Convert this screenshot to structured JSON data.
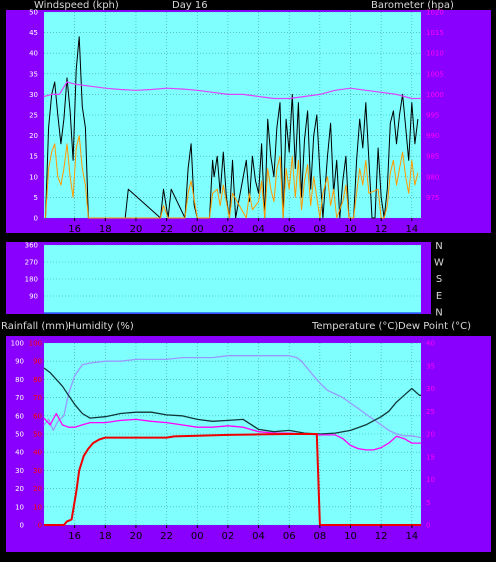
{
  "colors": {
    "background": "#000000",
    "frame": "#8a00ff",
    "plot_bg": "#80ffff",
    "grid": "#40a0a0",
    "label": "#d8d8d8",
    "tick_white": "#ffffff",
    "tick_magenta": "#ff00ff",
    "tick_red": "#ff0000"
  },
  "chart_data": [
    {
      "type": "line",
      "title": "Day 16",
      "ylabel": "Windspeed (kph)",
      "y2label": "Barometer (hpa)",
      "ylim": [
        0,
        50
      ],
      "y2lim": [
        970,
        1020
      ],
      "yticks": [
        0,
        5,
        10,
        15,
        20,
        25,
        30,
        35,
        40,
        45,
        50
      ],
      "y2ticks": [
        975,
        980,
        985,
        990,
        995,
        1000,
        1005,
        1010,
        1015,
        1020
      ],
      "xlim": [
        14.0,
        38.6
      ],
      "xticks": [
        16,
        18,
        20,
        22,
        24,
        26,
        28,
        30,
        32,
        34,
        36,
        38
      ],
      "xticklabels": [
        "16",
        "18",
        "20",
        "22",
        "00",
        "02",
        "04",
        "06",
        "08",
        "10",
        "12",
        "14"
      ],
      "series": [
        {
          "role": "gust",
          "color": "#000000",
          "axis": "left",
          "x": [
            14.1,
            14.3,
            14.5,
            14.7,
            14.9,
            15.1,
            15.3,
            15.5,
            15.7,
            15.9,
            16.1,
            16.3,
            16.5,
            16.7,
            16.9,
            19.3,
            19.5,
            21.6,
            21.8,
            22.1,
            22.3,
            23.2,
            23.4,
            23.6,
            23.8,
            24.0,
            24.8,
            25.0,
            25.1,
            25.3,
            25.5,
            25.7,
            25.9,
            26.1,
            26.3,
            26.5,
            27.2,
            27.4,
            27.6,
            27.8,
            28.0,
            28.2,
            28.4,
            28.6,
            28.8,
            29.0,
            29.2,
            29.4,
            29.6,
            29.8,
            30.0,
            30.2,
            30.4,
            30.6,
            30.8,
            31.0,
            31.2,
            31.4,
            31.6,
            31.8,
            32.0,
            32.2,
            32.5,
            32.7,
            32.9,
            33.1,
            33.3,
            33.5,
            33.7,
            33.9,
            34.2,
            34.4,
            34.6,
            34.8,
            35.0,
            35.2,
            35.4,
            35.6,
            35.8,
            36.0,
            36.2,
            36.4,
            36.6,
            36.8,
            37.0,
            37.2,
            37.4,
            37.6,
            37.8,
            38.0,
            38.2,
            38.4
          ],
          "y": [
            0,
            22,
            30,
            33,
            25,
            18,
            24,
            34,
            26,
            14,
            36,
            44,
            27,
            22,
            0,
            0,
            7,
            0,
            7,
            0,
            7,
            0,
            12,
            18,
            3,
            0,
            0,
            14,
            10,
            15,
            6,
            16,
            5,
            0,
            14,
            0,
            14,
            4,
            15,
            9,
            6,
            18,
            0,
            24,
            15,
            10,
            22,
            28,
            0,
            24,
            16,
            30,
            12,
            28,
            5,
            19,
            26,
            7,
            20,
            25,
            11,
            0,
            15,
            23,
            6,
            14,
            0,
            9,
            15,
            0,
            0,
            14,
            24,
            17,
            28,
            14,
            0,
            0,
            17,
            5,
            0,
            7,
            23,
            26,
            18,
            25,
            30,
            22,
            14,
            28,
            18,
            24
          ]
        },
        {
          "role": "average",
          "color": "#ff9900",
          "axis": "left",
          "x": [
            14.1,
            14.3,
            14.5,
            14.7,
            14.9,
            15.1,
            15.3,
            15.5,
            15.7,
            15.9,
            16.1,
            16.3,
            16.5,
            16.7,
            16.9,
            21.6,
            21.8,
            22.1,
            23.2,
            23.4,
            23.6,
            24.0,
            24.8,
            25.0,
            25.3,
            25.5,
            25.7,
            26.1,
            26.3,
            27.2,
            27.4,
            27.6,
            28.0,
            28.2,
            28.4,
            28.6,
            28.8,
            29.0,
            29.2,
            29.4,
            29.6,
            29.8,
            30.0,
            30.2,
            30.4,
            30.6,
            30.8,
            31.0,
            31.2,
            31.4,
            31.6,
            32.0,
            32.2,
            32.5,
            32.7,
            32.9,
            33.1,
            33.5,
            33.7,
            33.9,
            34.2,
            34.4,
            34.6,
            34.8,
            35.0,
            35.2,
            35.8,
            36.0,
            36.2,
            36.4,
            36.6,
            36.8,
            37.0,
            37.2,
            37.4,
            37.6,
            37.8,
            38.0,
            38.2,
            38.4
          ],
          "y": [
            0,
            12,
            16,
            18,
            10,
            8,
            12,
            18,
            10,
            5,
            17,
            20,
            12,
            8,
            0,
            0,
            3,
            0,
            0,
            6,
            9,
            0,
            0,
            6,
            7,
            3,
            8,
            0,
            6,
            0,
            6,
            2,
            4,
            9,
            0,
            12,
            7,
            4,
            12,
            15,
            0,
            12,
            7,
            15,
            5,
            14,
            2,
            9,
            13,
            3,
            10,
            0,
            6,
            10,
            3,
            7,
            0,
            4,
            8,
            0,
            0,
            6,
            12,
            8,
            14,
            6,
            7,
            0,
            0,
            3,
            11,
            14,
            8,
            12,
            16,
            10,
            6,
            14,
            8,
            11
          ]
        },
        {
          "role": "pressure",
          "color": "#dd44ff",
          "axis": "right",
          "x": [
            14.0,
            14.5,
            15.0,
            15.5,
            16.0,
            17.0,
            18.0,
            19.0,
            20.0,
            21.0,
            22.0,
            23.0,
            24.0,
            25.0,
            26.0,
            27.0,
            28.0,
            29.0,
            30.0,
            31.0,
            32.0,
            33.0,
            34.0,
            35.0,
            36.0,
            37.0,
            38.0,
            38.6
          ],
          "y": [
            999.5,
            1000.0,
            1000.0,
            1003.0,
            1002.5,
            1002.0,
            1001.5,
            1001.2,
            1001.0,
            1001.2,
            1001.5,
            1001.3,
            1001.0,
            1000.5,
            1000.0,
            1000.0,
            999.5,
            999.0,
            999.0,
            999.5,
            1000.0,
            1001.0,
            1001.5,
            1001.0,
            1000.5,
            1000.0,
            999.0,
            999.0
          ]
        }
      ]
    },
    {
      "type": "line",
      "ylim": [
        0,
        360
      ],
      "yticks": [
        90,
        180,
        270,
        360
      ],
      "compass_labels": [
        "N",
        "W",
        "S",
        "E",
        "N"
      ],
      "xlim": [
        14.0,
        38.6
      ],
      "series": [
        {
          "role": "direction",
          "color": "#2266ff",
          "x": [
            14.0,
            38.6
          ],
          "y": [
            0,
            0
          ]
        }
      ]
    },
    {
      "type": "line",
      "ylabel": "Rainfall (mm)",
      "ylabel2": "Humidity (%)",
      "y2label": "Temperature (°C)",
      "y2label2": "Dew Point (°C)",
      "ylim": [
        0,
        100
      ],
      "yticks": [
        0,
        10,
        20,
        30,
        40,
        50,
        60,
        70,
        80,
        90,
        100
      ],
      "rain_ylim": [
        0,
        100
      ],
      "rain_ticks": [
        0,
        10,
        20,
        30,
        40,
        50,
        60,
        70,
        80,
        90,
        100
      ],
      "y2lim": [
        0,
        40
      ],
      "y2ticks": [
        0,
        5,
        10,
        15,
        20,
        25,
        30,
        35,
        40
      ],
      "xlim": [
        14.0,
        38.6
      ],
      "xticks": [
        16,
        18,
        20,
        22,
        24,
        26,
        28,
        30,
        32,
        34,
        36,
        38
      ],
      "xticklabels": [
        "16",
        "18",
        "20",
        "22",
        "00",
        "02",
        "04",
        "06",
        "08",
        "10",
        "12",
        "14"
      ],
      "series": [
        {
          "role": "humidity",
          "color": "#9999ff",
          "axis": "left",
          "x": [
            14.0,
            14.3,
            14.6,
            14.9,
            15.3,
            15.6,
            16.0,
            16.5,
            17.0,
            18.0,
            19.0,
            20.0,
            21.0,
            22.0,
            23.0,
            24.0,
            25.0,
            26.0,
            27.0,
            28.0,
            29.0,
            30.0,
            30.5,
            30.8,
            31.2,
            31.6,
            32.0,
            32.5,
            33.0,
            33.5,
            34.0,
            34.5,
            35.0,
            35.5,
            36.0,
            36.5,
            37.0,
            37.5,
            38.0,
            38.6
          ],
          "y": [
            55,
            58,
            52,
            57,
            60,
            72,
            82,
            88,
            89,
            90,
            90,
            91,
            91,
            91,
            92,
            92,
            92,
            93,
            93,
            93,
            93,
            93,
            92,
            90,
            86,
            82,
            78,
            74,
            72,
            70,
            67,
            64,
            61,
            58,
            55,
            52,
            50,
            49,
            49,
            48
          ]
        },
        {
          "role": "temperature",
          "color": "#103838",
          "axis": "right",
          "x": [
            14.0,
            14.4,
            14.8,
            15.2,
            15.6,
            16.0,
            16.5,
            17.0,
            18.0,
            19.0,
            20.0,
            21.0,
            22.0,
            23.0,
            24.0,
            25.0,
            26.0,
            27.0,
            28.0,
            29.0,
            30.0,
            31.0,
            32.0,
            33.0,
            34.0,
            35.0,
            36.0,
            36.5,
            37.0,
            37.5,
            38.0,
            38.5,
            38.6
          ],
          "y": [
            34.5,
            33.5,
            32.0,
            30.5,
            28.5,
            26.5,
            24.5,
            23.5,
            23.8,
            24.5,
            24.8,
            24.8,
            24.2,
            24.0,
            23.2,
            22.8,
            23.0,
            23.2,
            21.0,
            20.5,
            20.8,
            20.2,
            20.0,
            20.2,
            20.8,
            22.0,
            23.8,
            25.0,
            27.0,
            28.5,
            30.0,
            28.5,
            28.5
          ]
        },
        {
          "role": "dew_point",
          "color": "#ff00ff",
          "axis": "right",
          "x": [
            14.0,
            14.4,
            14.8,
            15.2,
            15.6,
            16.0,
            16.5,
            17.0,
            18.0,
            19.0,
            20.0,
            21.0,
            22.0,
            23.0,
            24.0,
            25.0,
            26.0,
            27.0,
            28.0,
            29.0,
            30.0,
            31.0,
            32.0,
            33.0,
            33.5,
            34.0,
            34.5,
            35.0,
            35.5,
            36.0,
            36.5,
            37.0,
            37.5,
            38.0,
            38.6
          ],
          "y": [
            23.5,
            22.0,
            24.5,
            22.0,
            21.5,
            21.5,
            22.0,
            22.5,
            22.5,
            23.0,
            23.2,
            22.8,
            22.5,
            22.0,
            21.5,
            21.5,
            21.8,
            21.5,
            20.5,
            20.2,
            20.2,
            20.0,
            19.8,
            19.8,
            19.0,
            17.5,
            16.8,
            16.5,
            16.5,
            17.0,
            18.0,
            19.5,
            19.0,
            18.0,
            18.0
          ]
        },
        {
          "role": "rainfall",
          "color": "#ee0000",
          "axis": "rain",
          "x": [
            14.0,
            15.3,
            15.5,
            15.8,
            16.1,
            16.3,
            16.6,
            16.9,
            17.2,
            17.6,
            18.0,
            20.0,
            22.0,
            22.5,
            24.0,
            26.0,
            28.0,
            30.0,
            31.0,
            31.1,
            31.2,
            31.8,
            32.0,
            33.0,
            34.0,
            36.0,
            38.6
          ],
          "y": [
            0,
            0,
            2,
            3,
            18,
            30,
            38,
            42,
            45,
            47,
            48,
            48,
            48,
            48.7,
            49,
            49.5,
            49.8,
            50,
            50,
            50,
            50,
            50,
            0,
            0,
            0,
            0,
            0
          ]
        }
      ]
    }
  ]
}
